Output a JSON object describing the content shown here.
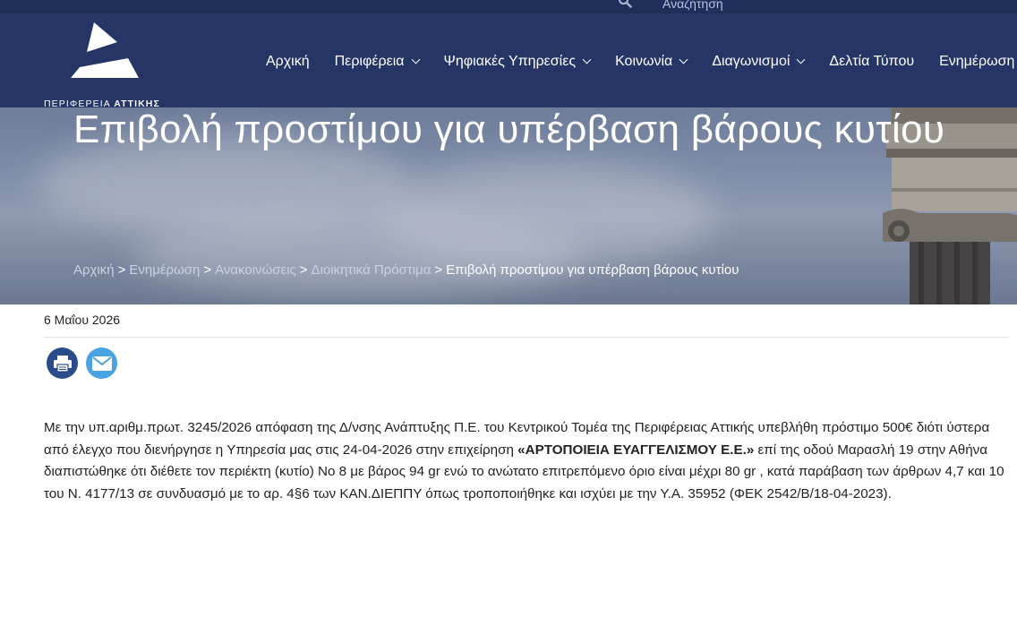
{
  "header": {
    "search_label": "Αναζήτηση",
    "logo_text_regular": "ΠΕΡΙΦΕΡΕΙΑ ",
    "logo_text_bold": "ΑΤΤΙΚΗΣ",
    "nav": [
      {
        "label": "Αρχική",
        "has_dropdown": false
      },
      {
        "label": "Περιφέρεια",
        "has_dropdown": true
      },
      {
        "label": "Ψηφιακές Υπηρεσίες",
        "has_dropdown": true
      },
      {
        "label": "Κοινωνία",
        "has_dropdown": true
      },
      {
        "label": "Διαγωνισμοί",
        "has_dropdown": true
      },
      {
        "label": "Δελτία Τύπου",
        "has_dropdown": false
      },
      {
        "label": "Ενημέρωση",
        "has_dropdown": false
      }
    ]
  },
  "hero": {
    "title": "Επιβολή προστίμου για υπέρβαση βάρους κυτίου",
    "breadcrumb": [
      "Αρχική",
      "Ενημέρωση",
      "Ανακοινώσεις",
      "Διοικητικά Πρόστιμα"
    ],
    "breadcrumb_separator": ">",
    "breadcrumb_current": "Επιβολή προστίμου για υπέρβαση βάρους κυτίου"
  },
  "article": {
    "date": "6 Μαΐου 2026",
    "share_icons": [
      "print-icon",
      "email-icon"
    ],
    "body_before": "Με την υπ.αριθμ.πρωτ. 3245/2026 απόφαση της Δ/νσης Ανάπτυξης Π.Ε. του Κεντρικού Τομέα της Περιφέρειας Αττικής υπεβλήθη πρόστιμο 500€ διότι ύστερα από έλεγχο που διενήργησε η Υπηρεσία μας στις 24-04-2026 στην επιχείρηση ",
    "body_bold": "«ΑΡΤΟΠΟΙΕΙΑ ΕΥΑΓΓΕΛΙΣΜΟΥ Ε.Ε.»",
    "body_after": " επί της οδού Μαρασλή 19 στην Αθήνα διαπιστώθηκε ότι διέθετε τον  περιέκτη (κυτίο) Νο 8 με βάρος 94 gr ενώ το ανώτατο επιτρεπόμενο όριο είναι μέχρι 80 gr , κατά παράβαση των άρθρων  4,7 και 10 του Ν. 4177/13 σε συνδυασμό με το αρ. 4§6 των ΚΑΝ.ΔΙΕΠΠΥ όπως τροποποιήθηκε και ισχύει με την Υ.Α. 35952 (ΦΕΚ 2542/Β/18-04-2023)."
  },
  "colors": {
    "navbar": "#243566",
    "topbar": "#1f2e5a",
    "print_button": "#2b4c8a",
    "email_button": "#4aa3e0"
  }
}
